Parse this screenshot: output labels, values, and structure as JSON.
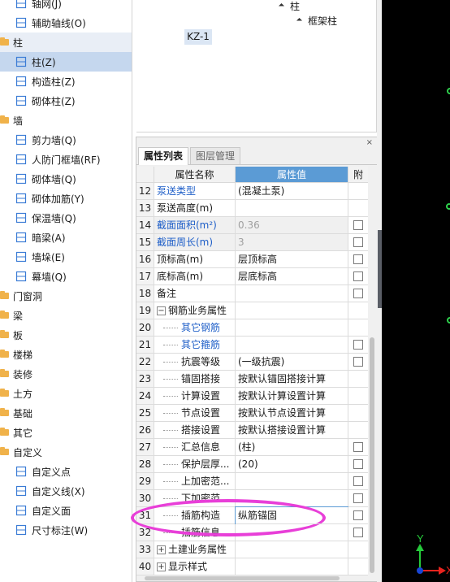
{
  "nav": {
    "items": [
      {
        "type": "sub",
        "label": "轴网(J)",
        "icon": "axis-grid-icon"
      },
      {
        "type": "sub",
        "label": "辅助轴线(O)",
        "icon": "auxiliary-axis-icon"
      },
      {
        "type": "cat",
        "label": "柱",
        "state": "selected-category"
      },
      {
        "type": "sub",
        "label": "柱(Z)",
        "icon": "column-icon",
        "state": "selected"
      },
      {
        "type": "sub",
        "label": "构造柱(Z)",
        "icon": "construction-column-icon"
      },
      {
        "type": "sub",
        "label": "砌体柱(Z)",
        "icon": "masonry-column-icon"
      },
      {
        "type": "cat",
        "label": "墙"
      },
      {
        "type": "sub",
        "label": "剪力墙(Q)",
        "icon": "shear-wall-icon"
      },
      {
        "type": "sub",
        "label": "人防门框墙(RF)",
        "icon": "civil-defense-door-wall-icon"
      },
      {
        "type": "sub",
        "label": "砌体墙(Q)",
        "icon": "masonry-wall-icon"
      },
      {
        "type": "sub",
        "label": "砌体加筋(Y)",
        "icon": "masonry-reinforcement-icon"
      },
      {
        "type": "sub",
        "label": "保温墙(Q)",
        "icon": "insulation-wall-icon"
      },
      {
        "type": "sub",
        "label": "暗梁(A)",
        "icon": "hidden-beam-icon"
      },
      {
        "type": "sub",
        "label": "墙垛(E)",
        "icon": "wall-pier-icon"
      },
      {
        "type": "sub",
        "label": "幕墙(Q)",
        "icon": "curtain-wall-icon"
      },
      {
        "type": "cat",
        "label": "门窗洞"
      },
      {
        "type": "cat",
        "label": "梁"
      },
      {
        "type": "cat",
        "label": "板"
      },
      {
        "type": "cat",
        "label": "楼梯"
      },
      {
        "type": "cat",
        "label": "装修"
      },
      {
        "type": "cat",
        "label": "土方"
      },
      {
        "type": "cat",
        "label": "基础"
      },
      {
        "type": "cat",
        "label": "其它"
      },
      {
        "type": "cat",
        "label": "自定义"
      },
      {
        "type": "sub",
        "label": "自定义点",
        "icon": "custom-point-icon"
      },
      {
        "type": "sub",
        "label": "自定义线(X)",
        "icon": "custom-line-icon"
      },
      {
        "type": "sub",
        "label": "自定义面",
        "icon": "custom-face-icon"
      },
      {
        "type": "sub",
        "label": "尺寸标注(W)",
        "icon": "dimension-icon"
      }
    ]
  },
  "tree": {
    "root": "柱",
    "child": "框架柱",
    "leaf": "KZ-1"
  },
  "panel": {
    "close_glyph": "×",
    "tabs": [
      "属性列表",
      "图层管理"
    ],
    "headers": {
      "name": "属性名称",
      "value": "属性值",
      "attach": "附"
    },
    "rows": [
      {
        "num": "12",
        "name": "泵送类型",
        "value": "(混凝土泵)",
        "blue": true,
        "check": false,
        "grey": false
      },
      {
        "num": "13",
        "name": "泵送高度(m)",
        "value": "",
        "blue": false,
        "check": false,
        "grey": false
      },
      {
        "num": "14",
        "name": "截面面积(m²)",
        "value": "0.36",
        "blue": true,
        "check": true,
        "grey": true
      },
      {
        "num": "15",
        "name": "截面周长(m)",
        "value": "3",
        "blue": true,
        "check": true,
        "grey": true
      },
      {
        "num": "16",
        "name": "顶标高(m)",
        "value": "层顶标高",
        "blue": false,
        "check": true,
        "grey": false
      },
      {
        "num": "17",
        "name": "底标高(m)",
        "value": "层底标高",
        "blue": false,
        "check": true,
        "grey": false
      },
      {
        "num": "18",
        "name": "备注",
        "value": "",
        "blue": false,
        "check": true,
        "grey": false
      },
      {
        "num": "19",
        "name": "钢筋业务属性",
        "value": "",
        "blue": false,
        "check": false,
        "grey": false,
        "group": "-"
      },
      {
        "num": "20",
        "name": "其它钢筋",
        "value": "",
        "blue": true,
        "check": false,
        "grey": false,
        "child": true
      },
      {
        "num": "21",
        "name": "其它箍筋",
        "value": "",
        "blue": true,
        "check": true,
        "grey": false,
        "child": true
      },
      {
        "num": "22",
        "name": "抗震等级",
        "value": "(一级抗震)",
        "blue": false,
        "check": true,
        "grey": false,
        "child": true
      },
      {
        "num": "23",
        "name": "锚固搭接",
        "value": "按默认锚固搭接计算",
        "blue": false,
        "check": false,
        "grey": false,
        "child": true
      },
      {
        "num": "24",
        "name": "计算设置",
        "value": "按默认计算设置计算",
        "blue": false,
        "check": false,
        "grey": false,
        "child": true
      },
      {
        "num": "25",
        "name": "节点设置",
        "value": "按默认节点设置计算",
        "blue": false,
        "check": false,
        "grey": false,
        "child": true
      },
      {
        "num": "26",
        "name": "搭接设置",
        "value": "按默认搭接设置计算",
        "blue": false,
        "check": false,
        "grey": false,
        "child": true
      },
      {
        "num": "27",
        "name": "汇总信息",
        "value": "(柱)",
        "blue": false,
        "check": true,
        "grey": false,
        "child": true
      },
      {
        "num": "28",
        "name": "保护层厚...",
        "value": "(20)",
        "blue": false,
        "check": true,
        "grey": false,
        "child": true
      },
      {
        "num": "29",
        "name": "上加密范...",
        "value": "",
        "blue": false,
        "check": true,
        "grey": false,
        "child": true
      },
      {
        "num": "30",
        "name": "下加密范...",
        "value": "",
        "blue": false,
        "check": true,
        "grey": false,
        "child": true
      },
      {
        "num": "31",
        "name": "插筋构造",
        "value": "纵筋锚固",
        "blue": false,
        "check": true,
        "grey": false,
        "child": true,
        "editing": true
      },
      {
        "num": "32",
        "name": "插筋信息",
        "value": "",
        "blue": false,
        "check": true,
        "grey": false,
        "child": true
      },
      {
        "num": "33",
        "name": "土建业务属性",
        "value": "",
        "blue": false,
        "check": false,
        "grey": false,
        "group": "+"
      },
      {
        "num": "40",
        "name": "显示样式",
        "value": "",
        "blue": false,
        "check": false,
        "grey": false,
        "group": "+"
      }
    ]
  },
  "viewport": {
    "axis_y": "Y",
    "axis_x": "X",
    "colors": {
      "y_axis": "#25c93a",
      "x_axis": "#e8231e",
      "origin": "#1846d6",
      "highlight": "#e83fd8"
    }
  }
}
